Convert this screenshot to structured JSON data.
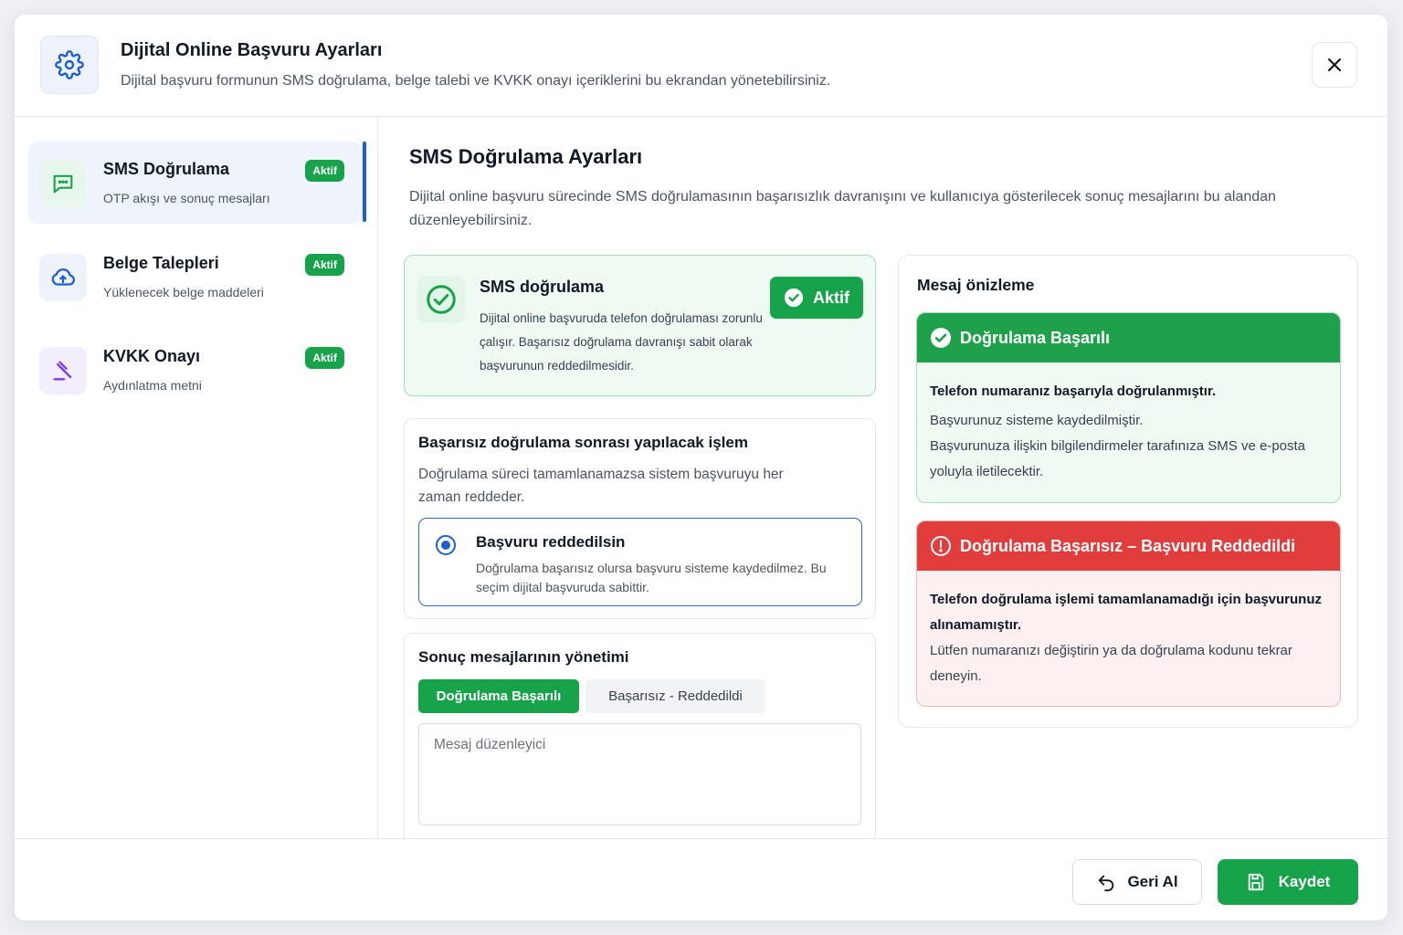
{
  "header": {
    "title": "Dijital Online Başvuru Ayarları",
    "subtitle": "Dijital başvuru formunun SMS doğrulama, belge talebi ve KVKK onayı içeriklerini bu ekrandan yönetebilirsiniz.",
    "icon": "gear-icon",
    "close_icon": "close-icon"
  },
  "sidebar": {
    "items": [
      {
        "title": "SMS Doğrulama",
        "subtitle": "OTP akışı ve sonuç mesajları",
        "badge": "Aktif",
        "icon": "chat-icon",
        "active": true
      },
      {
        "title": "Belge Talepleri",
        "subtitle": "Yüklenecek belge maddeleri",
        "badge": "Aktif",
        "icon": "cloud-upload-icon",
        "active": false
      },
      {
        "title": "KVKK Onayı",
        "subtitle": "Aydınlatma metni",
        "badge": "Aktif",
        "icon": "gavel-icon",
        "active": false
      }
    ]
  },
  "main": {
    "title": "SMS Doğrulama Ayarları",
    "description": "Dijital online başvuru sürecinde SMS doğrulamasının başarısızlık davranışını ve kullanıcıya gösterilecek sonuç mesajlarını bu alandan düzenleyebilirsiniz.",
    "sms_card": {
      "title": "SMS doğrulama",
      "text": "Dijital online başvuruda telefon doğrulaması zorunlu çalışır. Başarısız doğrulama davranışı sabit olarak başvurunun reddedilmesidir.",
      "status_button": "Aktif"
    },
    "fail_action": {
      "title": "Başarısız doğrulama sonrası yapılacak işlem",
      "description": "Doğrulama süreci tamamlanamazsa sistem başvuruyu her zaman reddeder.",
      "option_title": "Başvuru reddedilsin",
      "option_description": "Doğrulama başarısız olursa başvuru sisteme kaydedilmez. Bu seçim dijital başvuruda sabittir."
    },
    "messages": {
      "title": "Sonuç mesajlarının yönetimi",
      "tabs": [
        "Doğrulama Başarılı",
        "Başarısız - Reddedildi"
      ],
      "selected_tab": "Doğrulama Başarılı",
      "editor_placeholder": "Mesaj düzenleyici",
      "editor_value": ""
    }
  },
  "preview": {
    "title": "Mesaj önizleme",
    "success": {
      "header": "Doğrulama Başarılı",
      "strong": "Telefon numaranız başarıyla doğrulanmıştır.",
      "line1": "Başvurunuz sisteme kaydedilmiştir.",
      "line2": "Başvurunuza ilişkin bilgilendirmeler tarafınıza SMS ve e-posta yoluyla iletilecektir."
    },
    "fail": {
      "header": "Doğrulama Başarısız – Başvuru Reddedildi",
      "strong": "Telefon doğrulama işlemi tamamlanamadığı için başvurunuz alınamamıştır.",
      "line1": "Lütfen numaranızı değiştirin ya da doğrulama kodunu tekrar deneyin."
    }
  },
  "footer": {
    "undo_label": "Geri Al",
    "save_label": "Kaydet"
  },
  "colors": {
    "accent_green": "#16a34a",
    "accent_blue": "#1d5fd3",
    "danger_red": "#e23d3d"
  }
}
